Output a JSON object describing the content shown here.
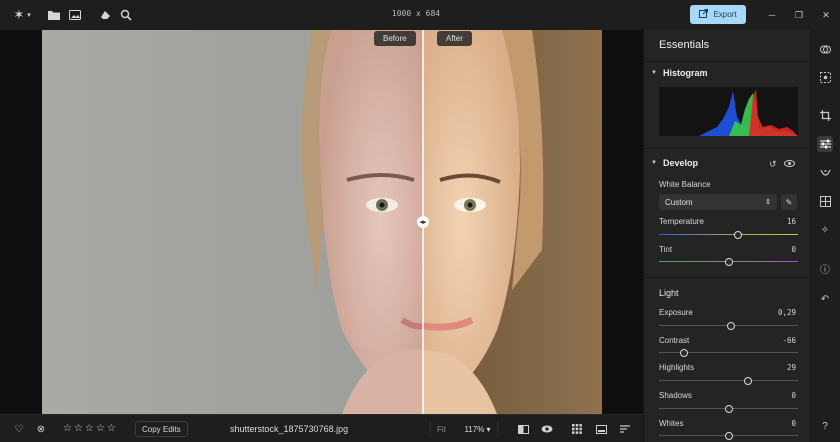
{
  "topbar": {
    "icons": [
      "sparkle-menu-icon",
      "chevron-down-icon",
      "folder-icon",
      "image-import-icon",
      "eraser-icon",
      "search-zoom-icon"
    ],
    "dimensions": "1000 x 684",
    "export_label": "Export",
    "export_icon": "export-icon"
  },
  "window_controls": [
    "minimize-icon",
    "restore-icon",
    "close-icon"
  ],
  "compare": {
    "before_label": "Before",
    "after_label": "After",
    "handle_icon": "drag-arrows-icon"
  },
  "bottombar": {
    "stars": "☆☆☆☆☆",
    "copy_edits_label": "Copy Edits",
    "filename": "shutterstock_1875730768.jpg",
    "fit_label": "Fit",
    "zoom_label": "117% ▾"
  },
  "panel": {
    "title": "Essentials",
    "histogram_label": "Histogram",
    "develop_label": "Develop",
    "white_balance_label": "White Balance",
    "white_balance_value": "Custom",
    "sliders": {
      "temperature": {
        "label": "Temperature",
        "value": "16",
        "position": 0.57
      },
      "tint": {
        "label": "Tint",
        "value": "0",
        "position": 0.5
      },
      "exposure": {
        "label": "Exposure",
        "value": "0,29",
        "position": 0.52
      },
      "contrast": {
        "label": "Contrast",
        "value": "-66",
        "position": 0.18
      },
      "highlights": {
        "label": "Highlights",
        "value": "29",
        "position": 0.64
      },
      "shadows": {
        "label": "Shadows",
        "value": "0",
        "position": 0.5
      },
      "whites": {
        "label": "Whites",
        "value": "0",
        "position": 0.5
      }
    },
    "light_label": "Light"
  },
  "rail": {
    "icons": [
      "layers-icon",
      "ai-select-icon",
      "crop-icon",
      "adjust-sliders-icon",
      "heal-icon",
      "grid-structure-icon",
      "magic-icon",
      "info-icon",
      "undo-history-icon",
      "help-icon"
    ]
  },
  "colors": {
    "accent_export": "#a8d7f7",
    "histogram_blue": "#1c4fd6",
    "histogram_green": "#37c44a",
    "histogram_red": "#e12626"
  }
}
